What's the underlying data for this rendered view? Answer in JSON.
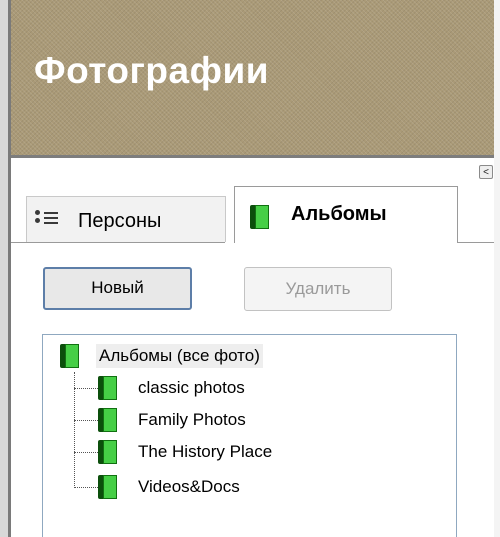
{
  "header": {
    "title": "Фотографии"
  },
  "panel": {
    "collapse_glyph": "<"
  },
  "tabs": [
    {
      "label": "Персоны",
      "icon": "persons-list-icon",
      "selected": false
    },
    {
      "label": "Альбомы",
      "icon": "album-book-icon",
      "selected": true
    }
  ],
  "buttons": {
    "new_label": "Новый",
    "delete_label": "Удалить",
    "delete_enabled": false
  },
  "tree": {
    "root": {
      "label": "Альбомы (все фото)",
      "icon": "album-book-icon"
    },
    "children": [
      {
        "label": "classic photos",
        "icon": "album-book-icon"
      },
      {
        "label": "Family Photos",
        "icon": "album-book-icon"
      },
      {
        "label": "The History Place",
        "icon": "album-book-icon"
      },
      {
        "label": "Videos&Docs",
        "icon": "album-book-icon"
      }
    ]
  },
  "colors": {
    "header_bg": "#aa9a77",
    "book_green": "#46cf46",
    "book_spine": "#0c4f0c",
    "focus_border": "#5d7ea8"
  }
}
